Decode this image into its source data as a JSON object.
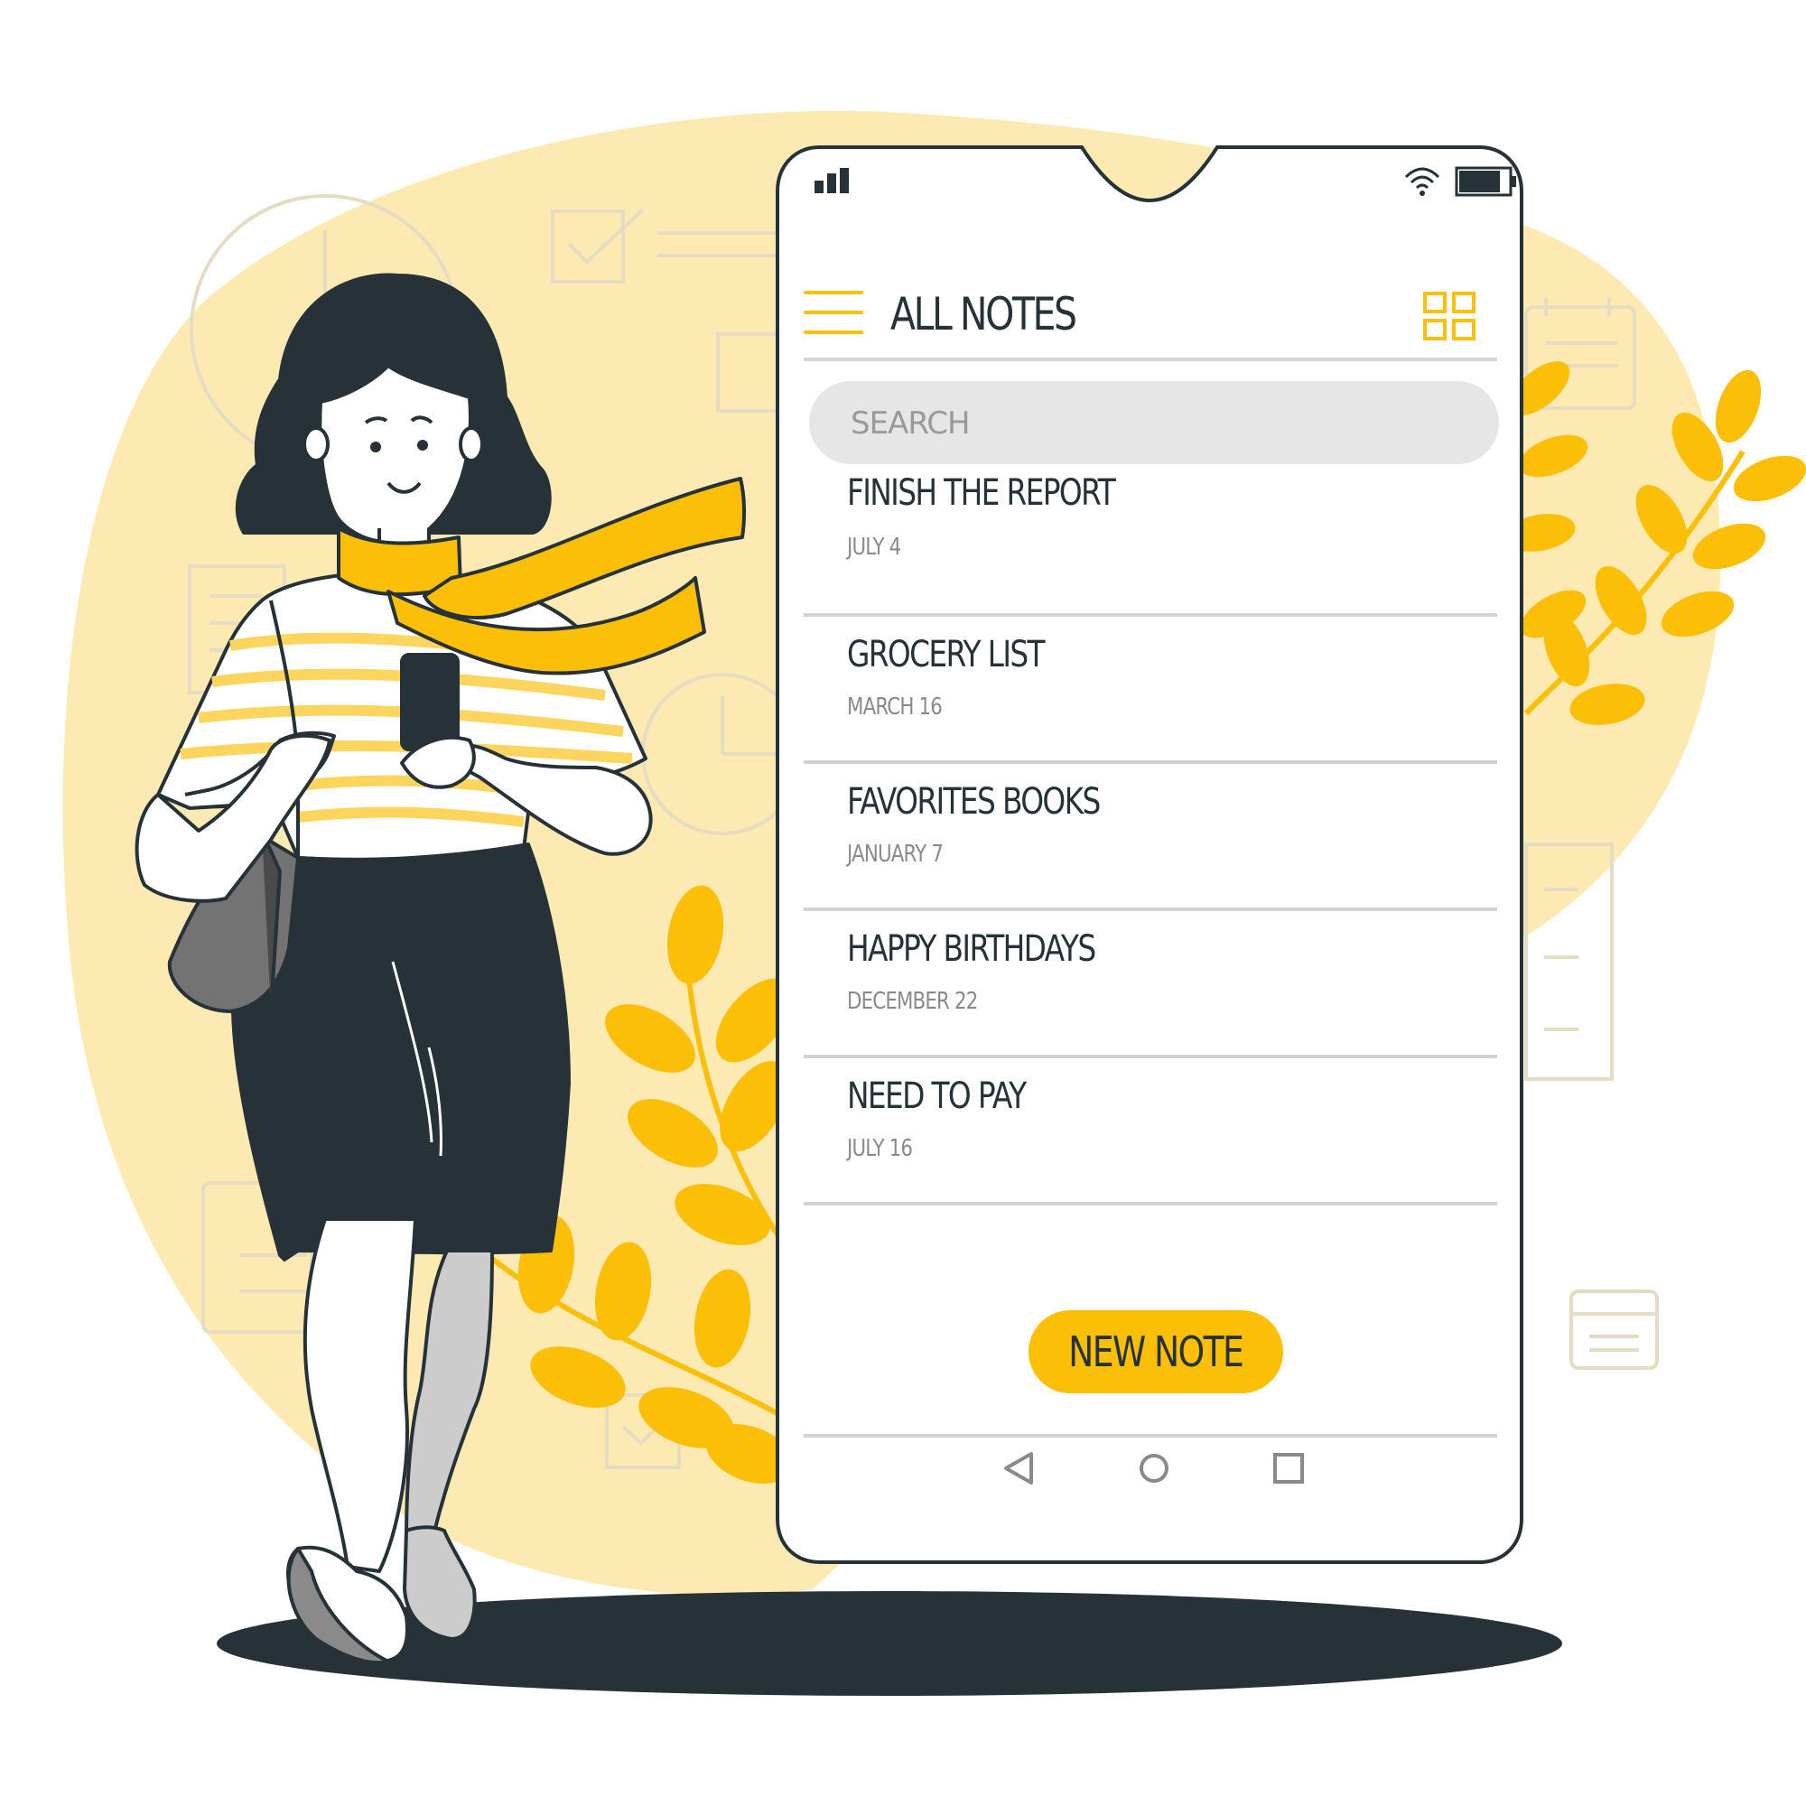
{
  "app": {
    "title": "ALL NOTES"
  },
  "search": {
    "placeholder": "SEARCH"
  },
  "notes": [
    {
      "title": "FINISH THE REPORT",
      "date": "JULY 4"
    },
    {
      "title": "GROCERY LIST",
      "date": "MARCH 16"
    },
    {
      "title": "FAVORITES BOOKS",
      "date": "JANUARY 7"
    },
    {
      "title": "HAPPY BIRTHDAYS",
      "date": "DECEMBER 22"
    },
    {
      "title": "NEED TO PAY",
      "date": "JULY 16"
    }
  ],
  "actions": {
    "new_note_label": "NEW NOTE"
  },
  "icons": {
    "menu": "hamburger-menu-icon",
    "view": "grid-view-icon",
    "signal": "signal-icon",
    "wifi": "wifi-icon",
    "battery": "battery-icon",
    "nav_back": "triangle-back-icon",
    "nav_home": "circle-home-icon",
    "nav_recent": "square-recent-icon"
  },
  "colors": {
    "accent": "#fbbf07",
    "dark": "#263238",
    "background_blob": "#fdeab2",
    "divider": "#d2d2d2",
    "search_bg": "#e6e6e6"
  }
}
